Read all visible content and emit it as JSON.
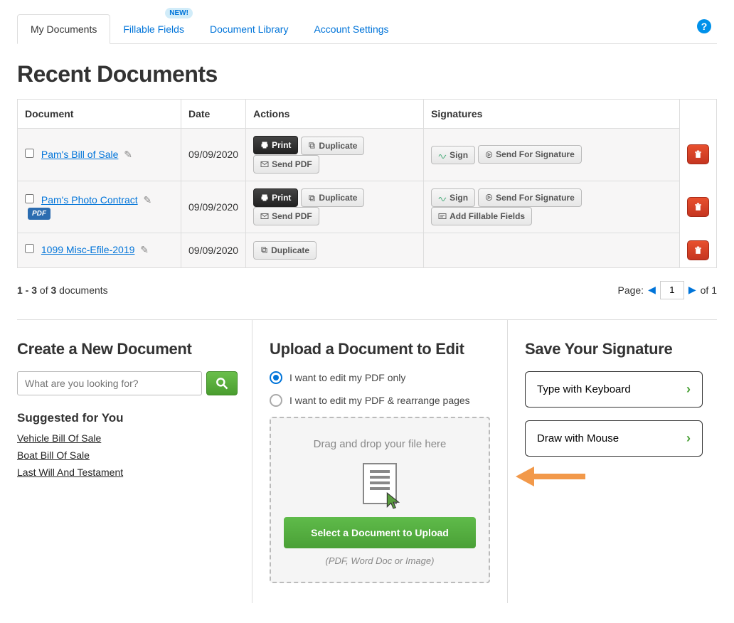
{
  "tabs": {
    "my_documents": "My Documents",
    "fillable_fields": "Fillable Fields",
    "document_library": "Document Library",
    "account_settings": "Account Settings",
    "new_badge": "NEW!"
  },
  "page_title": "Recent Documents",
  "table": {
    "headers": {
      "document": "Document",
      "date": "Date",
      "actions": "Actions",
      "signatures": "Signatures"
    },
    "rows": [
      {
        "name": "Pam's Bill of Sale",
        "date": "09/09/2020",
        "pdf_badge": false,
        "print": true,
        "send_pdf": true,
        "sign": true,
        "send_for_sig": true,
        "add_fillable": false
      },
      {
        "name": "Pam's Photo Contract",
        "date": "09/09/2020",
        "pdf_badge": true,
        "print": true,
        "send_pdf": true,
        "sign": true,
        "send_for_sig": true,
        "add_fillable": true
      },
      {
        "name": "1099 Misc-Efile-2019",
        "date": "09/09/2020",
        "pdf_badge": false,
        "print": false,
        "send_pdf": false,
        "sign": false,
        "send_for_sig": false,
        "add_fillable": false
      }
    ]
  },
  "action_labels": {
    "print": "Print",
    "duplicate": "Duplicate",
    "send_pdf": "Send PDF",
    "sign": "Sign",
    "send_for_signature": "Send For Signature",
    "add_fillable": "Add Fillable Fields",
    "pdf_badge": "PDF"
  },
  "pagination": {
    "summary_prefix": "1 - 3",
    "summary_mid": " of ",
    "summary_total": "3",
    "summary_suffix": " documents",
    "page_label": "Page:",
    "page_value": "1",
    "of_label": "of 1"
  },
  "create_section": {
    "heading": "Create a New Document",
    "search_placeholder": "What are you looking for?",
    "suggested_heading": "Suggested for You",
    "suggestions": [
      "Vehicle Bill Of Sale",
      "Boat Bill Of Sale",
      "Last Will And Testament"
    ]
  },
  "upload_section": {
    "heading": "Upload a Document to Edit",
    "option_edit_only": "I want to edit my PDF only",
    "option_edit_rearrange": "I want to edit my PDF & rearrange pages",
    "drop_text": "Drag and drop your file here",
    "upload_button": "Select a Document to Upload",
    "file_types": "(PDF, Word Doc or Image)"
  },
  "signature_section": {
    "heading": "Save Your Signature",
    "type_keyboard": "Type with Keyboard",
    "draw_mouse": "Draw with Mouse"
  }
}
